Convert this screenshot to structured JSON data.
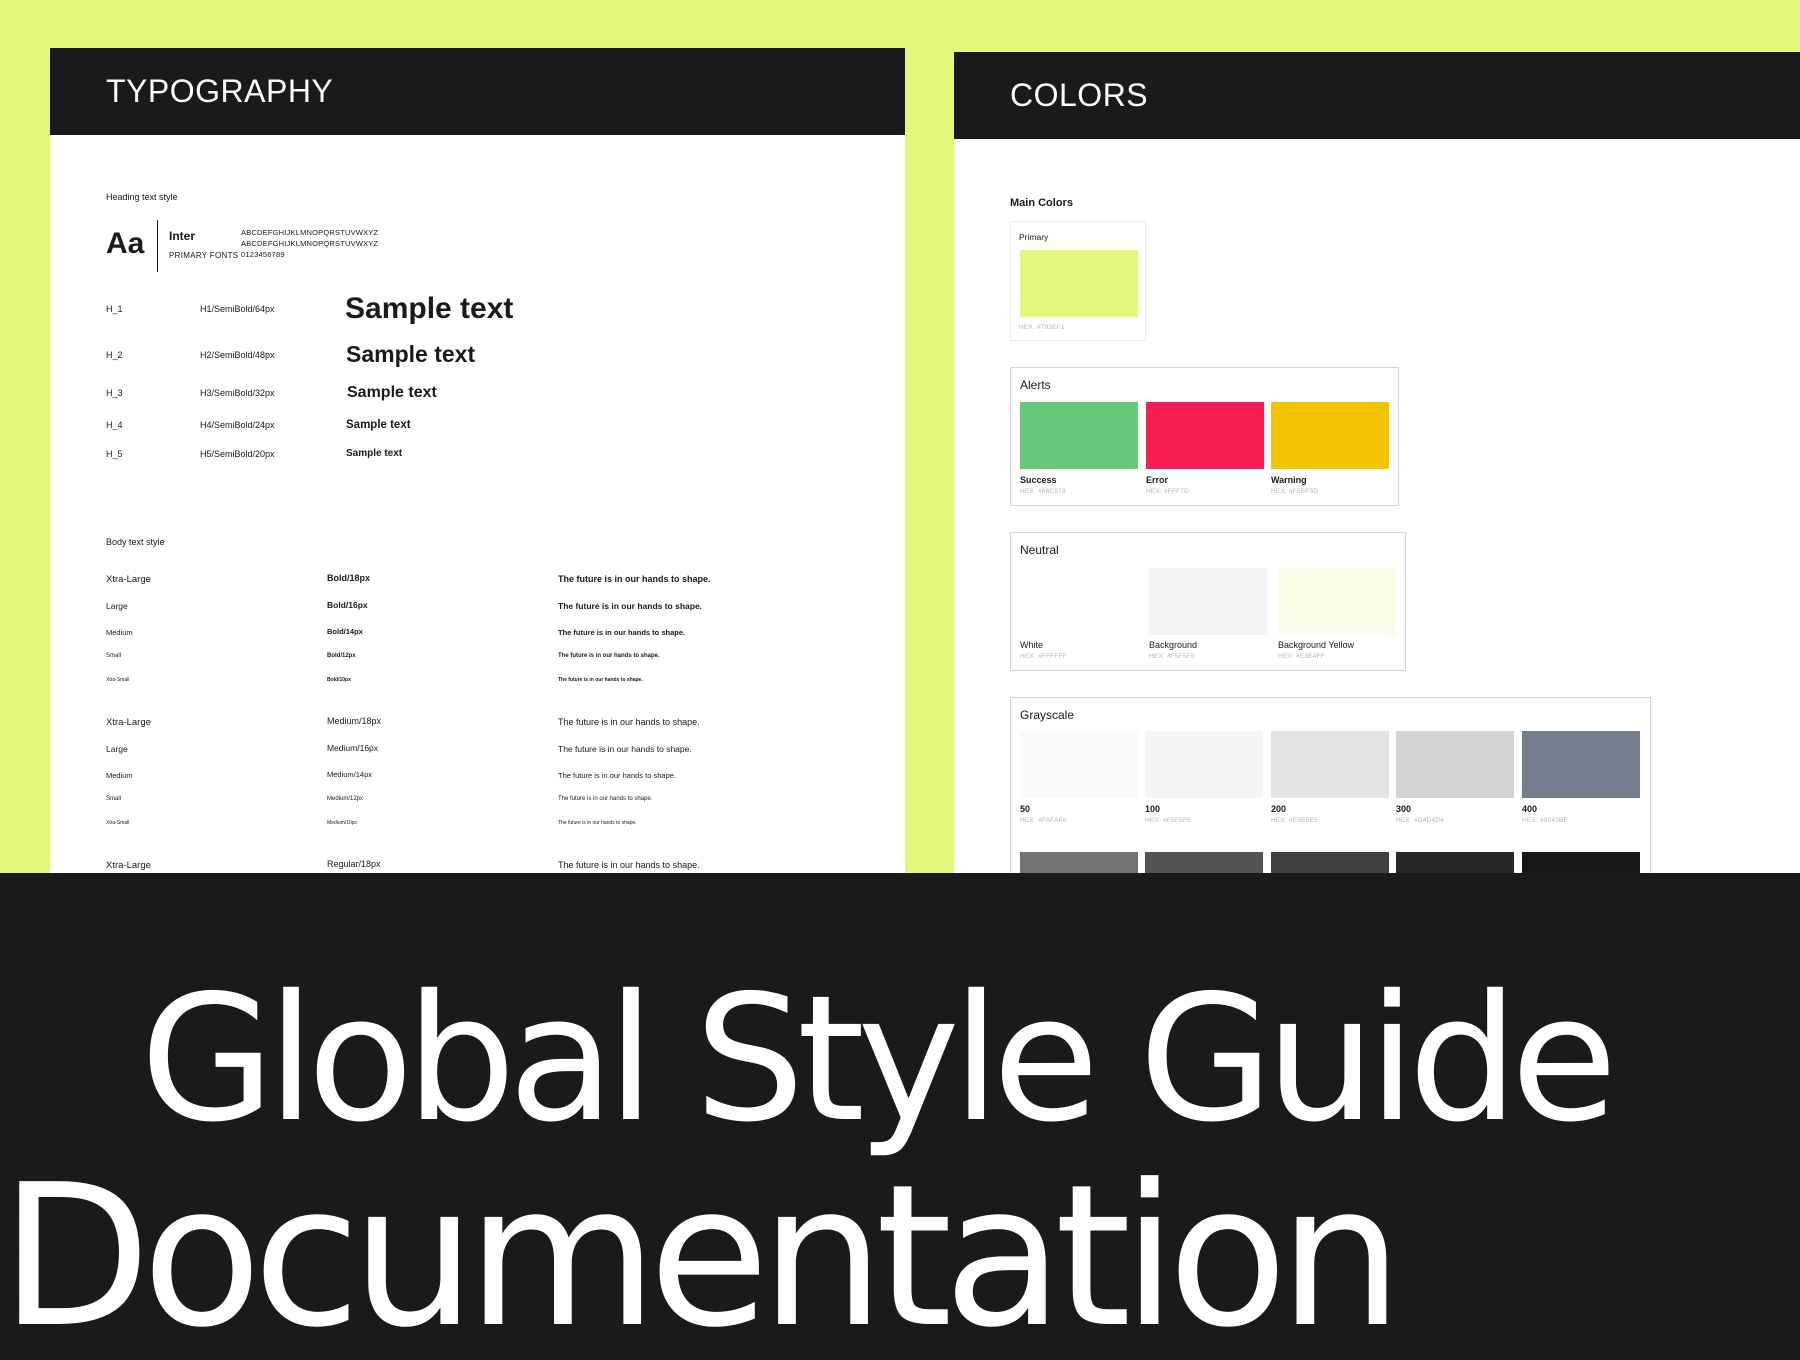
{
  "typography": {
    "header": "TYPOGRAPHY",
    "heading_caption": "Heading text style",
    "specimen": {
      "aa": "Aa",
      "font_name": "Inter",
      "role": "PRIMARY FONTS",
      "glyph_lines": [
        "ABCDEFGHIJKLMNOPQRSTUVWXYZ",
        "ABCDEFGHIJKLMNOPQRSTUVWXYZ",
        "0123456789"
      ]
    },
    "headings": [
      {
        "label": "H_1",
        "spec": "H1/SemiBold/64px",
        "sample": "Sample text"
      },
      {
        "label": "H_2",
        "spec": "H2/SemiBold/48px",
        "sample": "Sample text"
      },
      {
        "label": "H_3",
        "spec": "H3/SemiBold/32px",
        "sample": "Sample text"
      },
      {
        "label": "H_4",
        "spec": "H4/SemiBold/24px",
        "sample": "Sample text"
      },
      {
        "label": "H_5",
        "spec": "H5/SemiBold/20px",
        "sample": "Sample text"
      }
    ],
    "body_caption": "Body text style",
    "body_groups": [
      {
        "weight": "bold",
        "rows": [
          {
            "size": "Xtra-Large",
            "spec": "Bold/18px",
            "sample": "The future is in our hands to shape."
          },
          {
            "size": "Large",
            "spec": "Bold/16px",
            "sample": "The future is in our hands to shape."
          },
          {
            "size": "Medium",
            "spec": "Bold/14px",
            "sample": "The future is in our hands to shape."
          },
          {
            "size": "Small",
            "spec": "Bold/12px",
            "sample": "The future is in our hands to shape."
          },
          {
            "size": "Xtra-Small",
            "spec": "Bold/10px",
            "sample": "The future is in our hands to shape."
          }
        ]
      },
      {
        "weight": "medium",
        "rows": [
          {
            "size": "Xtra-Large",
            "spec": "Medium/18px",
            "sample": "The future is in our hands to shape."
          },
          {
            "size": "Large",
            "spec": "Medium/16px",
            "sample": "The future is in our hands to shape."
          },
          {
            "size": "Medium",
            "spec": "Medium/14px",
            "sample": "The future is in our hands to shape."
          },
          {
            "size": "Small",
            "spec": "Medium/12px",
            "sample": "The future is in our hands to shape."
          },
          {
            "size": "Xtra-Small",
            "spec": "Medium/10px",
            "sample": "The future is in our hands to shape."
          }
        ]
      },
      {
        "weight": "regular",
        "rows": [
          {
            "size": "Xtra-Large",
            "spec": "Regular/18px",
            "sample": "The future is in our hands to shape."
          }
        ]
      }
    ]
  },
  "colors": {
    "header": "COLORS",
    "main_colors_title": "Main Colors",
    "primary": {
      "title": "Primary",
      "hex_label": "HEX: #793EF1",
      "color": "#e2f77c"
    },
    "alerts": {
      "title": "Alerts",
      "swatches": [
        {
          "name": "Success",
          "hex_label": "HEX: #66C978",
          "color": "#66c979"
        },
        {
          "name": "Error",
          "hex_label": "HEX: #FFF7D",
          "color": "#f71c53"
        },
        {
          "name": "Warning",
          "hex_label": "HEX: #F5BF3D",
          "color": "#f3c400"
        }
      ]
    },
    "neutral": {
      "title": "Neutral",
      "swatches": [
        {
          "name": "White",
          "hex_label": "HEX: #FFFFFF",
          "color": "#ffffff"
        },
        {
          "name": "Background",
          "hex_label": "HEX: #F5F5F5",
          "color": "#f4f4f4"
        },
        {
          "name": "Background Yellow",
          "hex_label": "HEX: #E8E4FF",
          "color": "#f8fce8"
        }
      ]
    },
    "grayscale": {
      "title": "Grayscale",
      "swatches": [
        {
          "name": "50",
          "hex_label": "HEX: #FAFAFA",
          "color": "#fafafa"
        },
        {
          "name": "100",
          "hex_label": "HEX: #F5F5F5",
          "color": "#f5f5f5"
        },
        {
          "name": "200",
          "hex_label": "HEX: #E5E5E5",
          "color": "#e4e4e4"
        },
        {
          "name": "300",
          "hex_label": "HEX: #D4D4D4",
          "color": "#d4d4d4"
        },
        {
          "name": "400",
          "hex_label": "HEX: #9043BF",
          "color": "#737f8c"
        }
      ],
      "second_row_colors": [
        "#737373",
        "#525252",
        "#404040",
        "#262626",
        "#171717"
      ]
    }
  },
  "hero": {
    "line1": "Global Style Guide",
    "line2": "Documentation",
    "background": "#1a1a1a",
    "text_color": "#ffffff"
  },
  "page": {
    "accent_background": "#e4f77b"
  }
}
